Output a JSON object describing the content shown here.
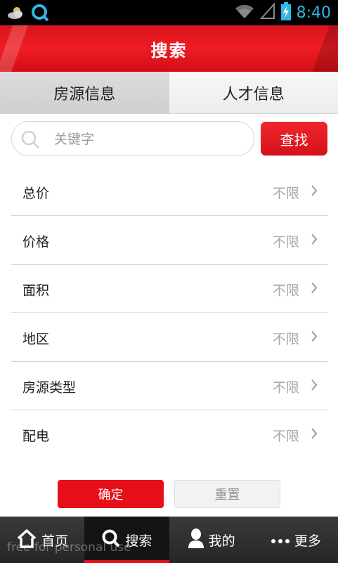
{
  "status_bar": {
    "time": "8:40",
    "icons": [
      "weather-icon",
      "app-notification-icon",
      "wifi-icon",
      "cell-signal-icon",
      "battery-charging-icon"
    ],
    "icon_color": "#33b5e5"
  },
  "header": {
    "title": "搜索"
  },
  "tabs": [
    {
      "label": "房源信息",
      "active": true
    },
    {
      "label": "人才信息",
      "active": false
    }
  ],
  "search": {
    "placeholder": "关键字",
    "value": "",
    "button_label": "查找"
  },
  "filters": [
    {
      "label": "总价",
      "value": "不限"
    },
    {
      "label": "价格",
      "value": "不限"
    },
    {
      "label": "面积",
      "value": "不限"
    },
    {
      "label": "地区",
      "value": "不限"
    },
    {
      "label": "房源类型",
      "value": "不限"
    },
    {
      "label": "配电",
      "value": "不限"
    }
  ],
  "actions": {
    "confirm_label": "确定",
    "reset_label": "重置"
  },
  "bottom_nav": [
    {
      "label": "首页",
      "icon": "home-icon",
      "active": false
    },
    {
      "label": "搜索",
      "icon": "search-icon",
      "active": true
    },
    {
      "label": "我的",
      "icon": "user-icon",
      "active": false
    },
    {
      "label": "更多",
      "icon": "more-icon",
      "active": false
    }
  ],
  "watermark": "free for personal use",
  "colors": {
    "accent": "#e60f1a",
    "status_blue": "#33b5e5",
    "nav_bg": "#2f2f2f"
  }
}
